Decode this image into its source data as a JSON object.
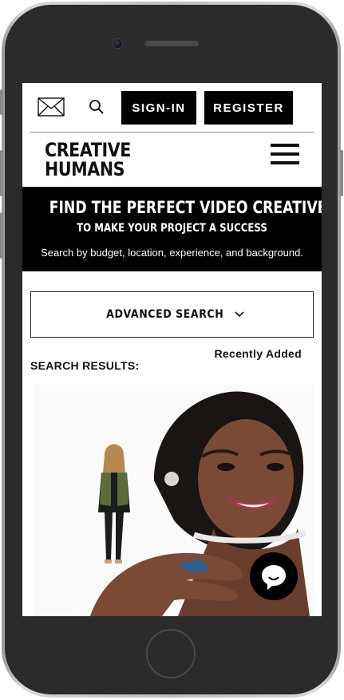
{
  "header": {
    "signin_label": "SIGN-IN",
    "register_label": "REGISTER"
  },
  "logo": {
    "line1": "CREATIVE",
    "line2": "HUMANS"
  },
  "hero": {
    "title": "FIND THE PERFECT VIDEO CREATIVE",
    "subtitle": "TO MAKE YOUR PROJECT A SUCCESS",
    "description": "Search by budget, location, experience, and background."
  },
  "search": {
    "advanced_label": "ADVANCED SEARCH",
    "sort_label": "Recently Added",
    "results_label": "SEARCH RESULTS:"
  },
  "icons": {
    "mail": "mail-icon",
    "search": "search-icon",
    "menu": "hamburger-menu-icon",
    "chevron": "chevron-down-icon",
    "chat": "chat-bubble-icon"
  },
  "colors": {
    "primary": "#000000",
    "background": "#ffffff",
    "text": "#111111"
  }
}
